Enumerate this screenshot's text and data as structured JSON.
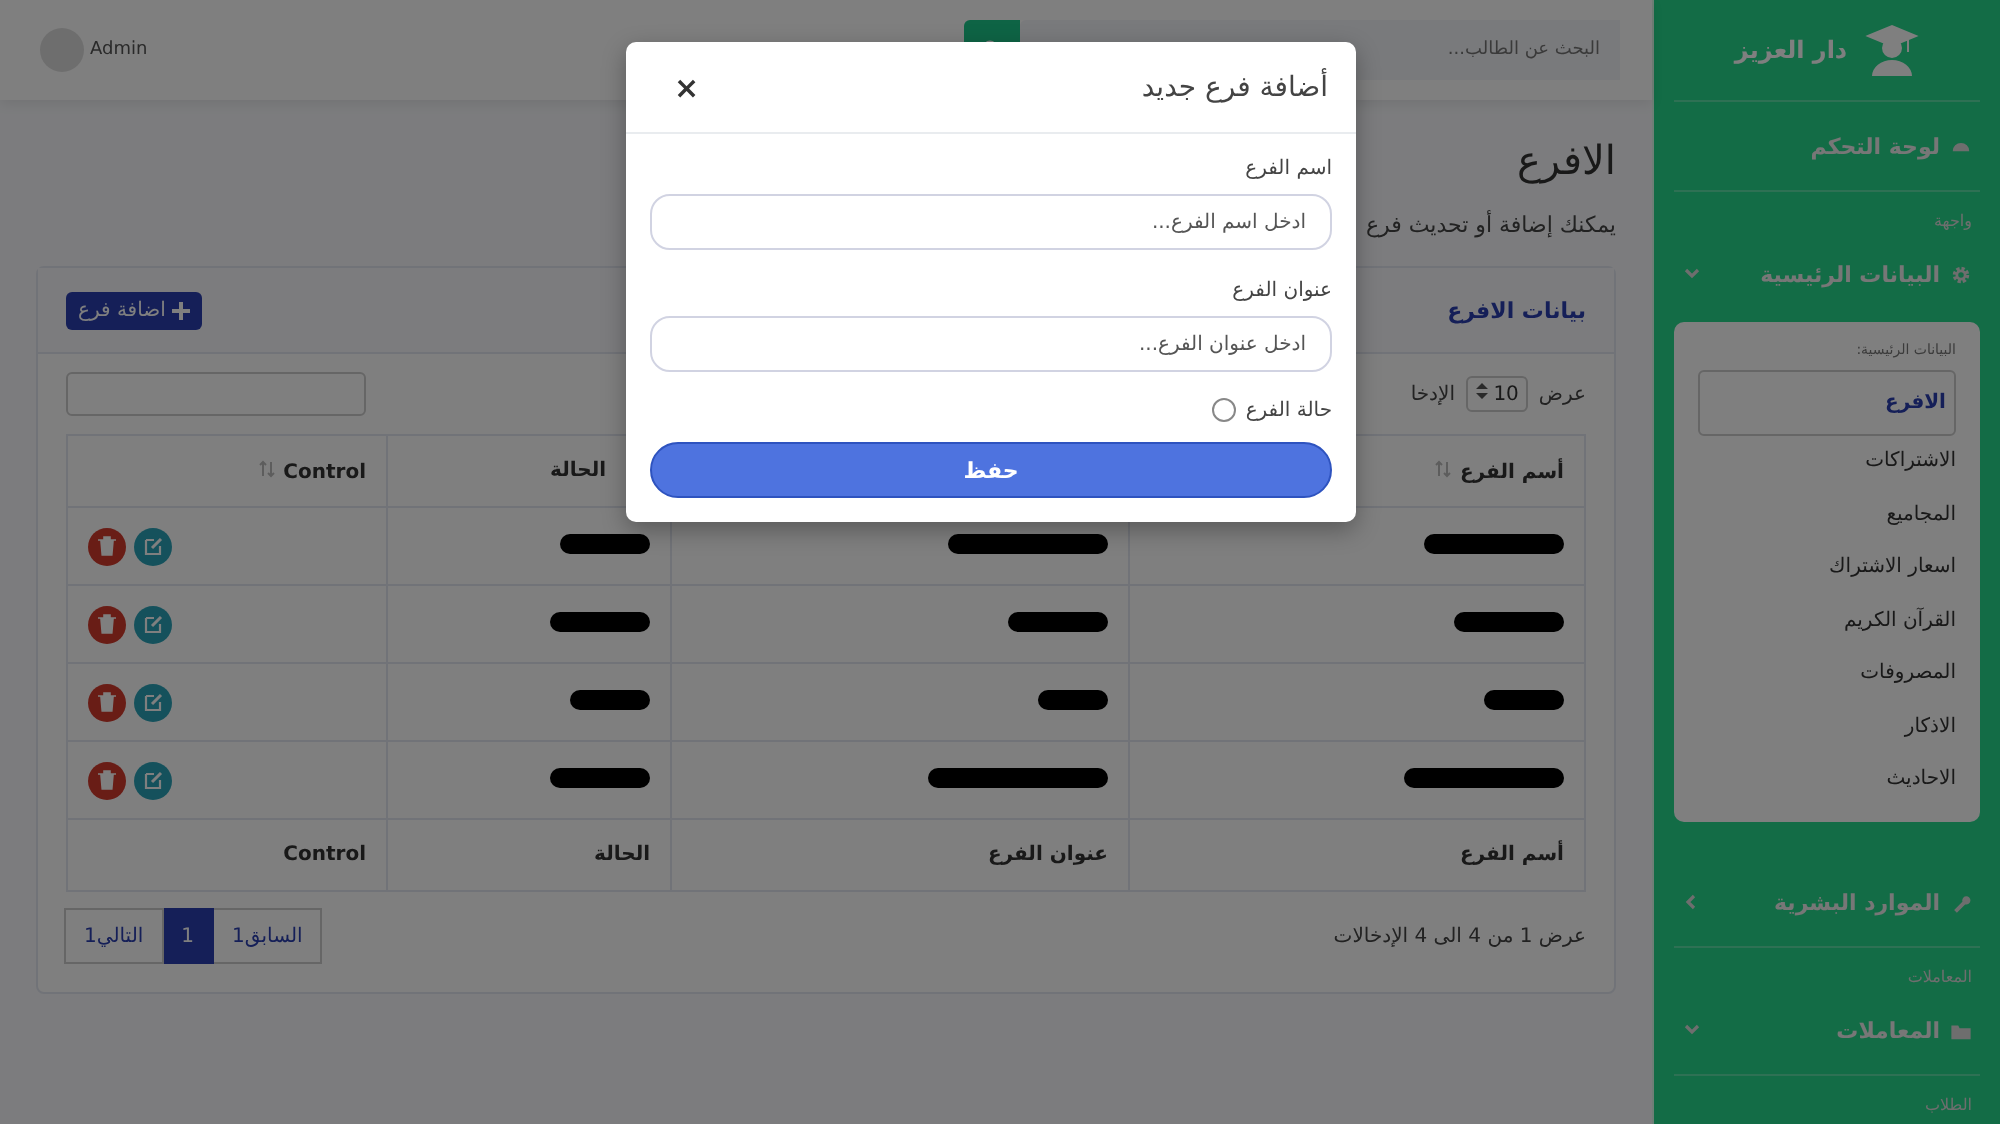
{
  "sidebar": {
    "brand": "دار العزيز",
    "items": [
      {
        "kind": "link",
        "label": "لوحة التحكم"
      },
      {
        "kind": "heading",
        "label": "واجهة"
      },
      {
        "kind": "group",
        "label": "البيانات الرئيسية",
        "expanded": true,
        "submenu_title": "البيانات الرئيسية:",
        "children": [
          {
            "label": "الافرع",
            "selected": true
          },
          {
            "label": "الاشتراكات",
            "selected": false
          },
          {
            "label": "المجاميع",
            "selected": false
          },
          {
            "label": "اسعار الاشتراك",
            "selected": false
          },
          {
            "label": "القرآن الكريم",
            "selected": false
          },
          {
            "label": "المصروفات",
            "selected": false
          },
          {
            "label": "الاذكار",
            "selected": false
          },
          {
            "label": "الاحاديث",
            "selected": false
          }
        ]
      },
      {
        "kind": "group",
        "label": "الموارد البشرية",
        "expanded": false
      },
      {
        "kind": "heading",
        "label": "المعاملات"
      },
      {
        "kind": "group",
        "label": "المعاملات",
        "expanded": true
      },
      {
        "kind": "heading",
        "label": "الطلاب"
      }
    ]
  },
  "topbar": {
    "search": {
      "placeholder": "البحث عن الطالب..."
    },
    "user": "Admin"
  },
  "page": {
    "title": "الافرع",
    "subtitle": "يمكنك إضافة أو تحديث فرع"
  },
  "card": {
    "title": "بيانات الافرع",
    "add_button": "اضافة فرع",
    "length": {
      "label": "عرض",
      "value": "10",
      "suffix": "الإدخا"
    },
    "table": {
      "header": [
        {
          "label": "أسم الفرع",
          "sortable": true
        },
        {
          "label": "الحالة",
          "sortable": false
        },
        {
          "label": "Control",
          "sortable": true
        }
      ],
      "footer": [
        "أسم الفرع",
        "عنوان الفرع",
        "الحالة",
        "Control"
      ],
      "rows": [
        {
          "kind": "redacted"
        },
        {
          "kind": "redacted"
        },
        {
          "kind": "redacted"
        },
        {
          "kind": "redacted"
        }
      ]
    },
    "info": "عرض 1 من 4 الى 4 الإدخالات",
    "pagination": [
      {
        "label": "السابق1",
        "selected": false
      },
      {
        "label": "1",
        "selected": true
      },
      {
        "label": "التالي1",
        "selected": false
      }
    ]
  },
  "modal": {
    "title": "أضافة فرع جديد",
    "close": "×",
    "fields": [
      {
        "kind": "text",
        "label": "اسم الفرع",
        "placeholder": "ادخل اسم الفرع..."
      },
      {
        "kind": "text",
        "label": "عنوان الفرع",
        "placeholder": "ادخل عنوان الفرع..."
      },
      {
        "kind": "checkbox",
        "label": "حالة الفرع",
        "checked": false
      }
    ],
    "submit": "حفظ"
  }
}
